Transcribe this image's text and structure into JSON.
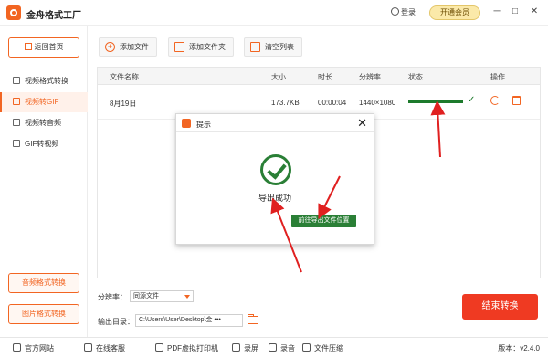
{
  "app": {
    "title": "金舟格式工厂",
    "login": "登录",
    "vip": "开通会员"
  },
  "window": {
    "minimize": "─",
    "maximize": "□",
    "close": "✕"
  },
  "sidebar": {
    "home": "返回首页",
    "items": [
      {
        "label": "视频格式转换"
      },
      {
        "label": "视频转GIF"
      },
      {
        "label": "视频转音频"
      },
      {
        "label": "GIF转视频"
      }
    ],
    "bottom_buttons": [
      "音频格式转换",
      "图片格式转换"
    ]
  },
  "toolbar": {
    "add_file": "添加文件",
    "add_folder": "添加文件夹",
    "clear_list": "清空列表"
  },
  "table": {
    "columns": [
      "文件名称",
      "大小",
      "时长",
      "分辨率",
      "状态",
      "操作"
    ],
    "rows": [
      {
        "name": "8月19日",
        "size": "173.7KB",
        "duration": "00:00:04",
        "resolution": "1440×1080",
        "progress": 1.0
      }
    ]
  },
  "settings": {
    "resolution_label": "分辨率：",
    "resolution_value": "同源文件",
    "output_label": "输出目录：",
    "output_path": "C:\\Users\\User\\Desktop\\金 •••"
  },
  "stop_button": "结束转换",
  "statusbar": {
    "items": [
      "官方网站",
      "在线客服",
      "PDF虚拟打印机",
      "录屏",
      "录音",
      "文件压缩"
    ],
    "version": "版本：v2.4.0"
  },
  "dialog": {
    "title": "提示",
    "close": "✕",
    "message": "导出成功",
    "button": "前往导出文件位置"
  },
  "colors": {
    "accent": "#f26522",
    "success": "#2a7f36",
    "danger": "#ef3a22"
  }
}
